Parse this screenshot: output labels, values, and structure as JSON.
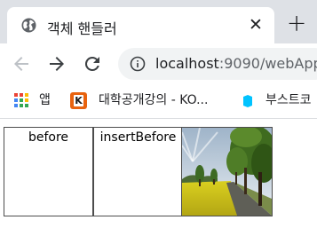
{
  "tab": {
    "title": "객체 핸들러",
    "close_symbol": "✕",
    "new_tab_symbol": "+"
  },
  "toolbar": {
    "url_host": "localhost",
    "url_rest": ":9090/webApp"
  },
  "bookmarks": {
    "items": [
      {
        "label": "앱",
        "icon": "apps-grid-icon"
      },
      {
        "label": "대학공개강의 - KO...",
        "icon": "kmooc-icon",
        "icon_letter": "K"
      },
      {
        "label": "부스트코",
        "icon": "boostcourse-icon"
      }
    ]
  },
  "page": {
    "boxes": [
      {
        "label": "before"
      },
      {
        "label": "insertBefore"
      },
      {
        "label": "",
        "content": "landscape-photo"
      }
    ]
  },
  "colors": {
    "tabstrip_bg": "#dee1e6",
    "omnibox_bg": "#f1f3f4",
    "box_border": "#4d4d4d",
    "kmooc_orange": "#e8620e",
    "boost_blue": "#00c3ff"
  }
}
